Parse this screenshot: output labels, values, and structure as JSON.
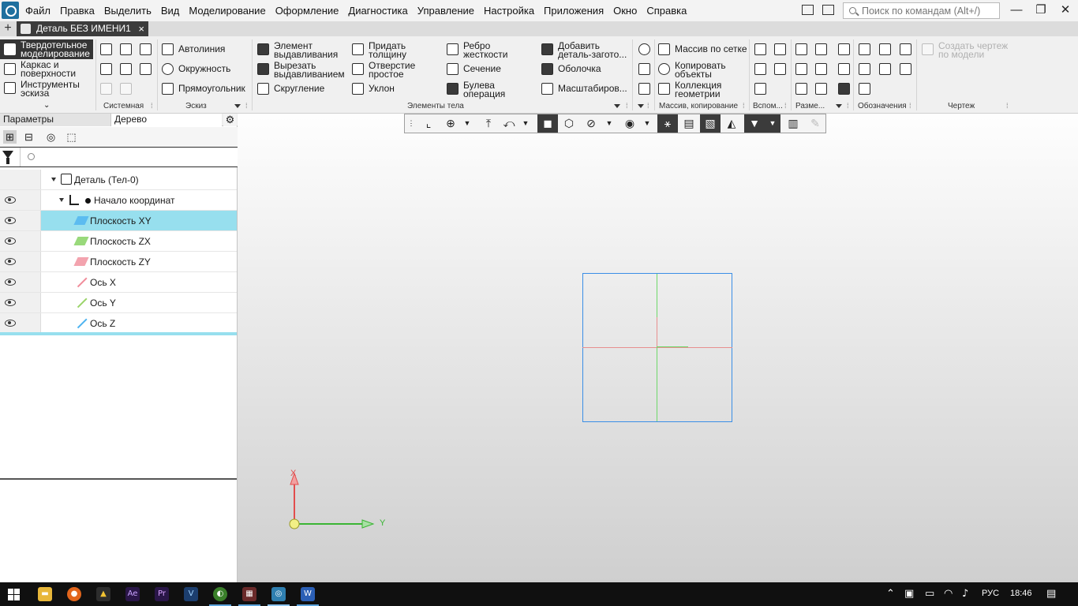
{
  "menu": [
    "Файл",
    "Правка",
    "Выделить",
    "Вид",
    "Моделирование",
    "Оформление",
    "Диагностика",
    "Управление",
    "Настройка",
    "Приложения",
    "Окно",
    "Справка"
  ],
  "search": {
    "placeholder": "Поиск по командам (Alt+/)"
  },
  "document_tab": {
    "title": "Деталь БЕЗ ИМЕНИ1",
    "close": "×"
  },
  "ribbon": {
    "modes": [
      "Твердотельное моделирование",
      "Каркас и поверхности",
      "Инструменты эскиза"
    ],
    "sketch": [
      "Автолиния",
      "Окружность",
      "Прямоугольник"
    ],
    "elements_col1": [
      [
        "Элемент",
        "выдавливания"
      ],
      [
        "Вырезать",
        "выдавливанием"
      ],
      [
        "Скругление"
      ]
    ],
    "elements_col2": [
      [
        "Придать",
        "толщину"
      ],
      [
        "Отверстие",
        "простое"
      ],
      [
        "Уклон"
      ]
    ],
    "elements_col3": [
      [
        "Ребро",
        "жесткости"
      ],
      [
        "Сечение"
      ],
      [
        "Булева",
        "операция"
      ]
    ],
    "elements_col4": [
      [
        "Добавить",
        "деталь-загото..."
      ],
      [
        "Оболочка"
      ],
      [
        "Масштабиров..."
      ]
    ],
    "array": [
      [
        "Массив по сетке"
      ],
      [
        "Копировать",
        "объекты"
      ],
      [
        "Коллекция",
        "геометрии"
      ]
    ],
    "drawing": [
      "Создать чертеж",
      "по модели"
    ],
    "group_labels": [
      "Системная",
      "Эскиз",
      "Элементы тела",
      "Массив, копирование",
      "Вспом...",
      "Разме...",
      "Обозначения",
      "Чертеж"
    ]
  },
  "left_panel": {
    "tabs": [
      "Параметры",
      "Дерево"
    ],
    "filter_placeholder": "",
    "tree": [
      {
        "label": "Деталь (Тел-0)",
        "level": 0,
        "eye": false
      },
      {
        "label": "Начало координат",
        "level": 1,
        "eye": true
      },
      {
        "label": "Плоскость XY",
        "level": 2,
        "eye": true,
        "selected": true,
        "color": "#4db3f0"
      },
      {
        "label": "Плоскость ZX",
        "level": 2,
        "eye": true,
        "color": "#7fcf5a"
      },
      {
        "label": "Плоскость ZY",
        "level": 2,
        "eye": true,
        "color": "#f08c9a"
      },
      {
        "label": "Ось X",
        "level": 2,
        "eye": true,
        "color": "#f08c9a"
      },
      {
        "label": "Ось Y",
        "level": 2,
        "eye": true,
        "color": "#9bd46a"
      },
      {
        "label": "Ось Z",
        "level": 2,
        "eye": true,
        "color": "#4db3f0"
      }
    ]
  },
  "viewport": {
    "triad_x": "X",
    "triad_y": "Y"
  },
  "taskbar": {
    "lang": "РУС",
    "clock": "18:46"
  },
  "colors": {
    "selection": "#97dfee",
    "plane_border": "#3a8ee6",
    "x_axis": "#e24d4d",
    "y_axis": "#3ab534"
  }
}
